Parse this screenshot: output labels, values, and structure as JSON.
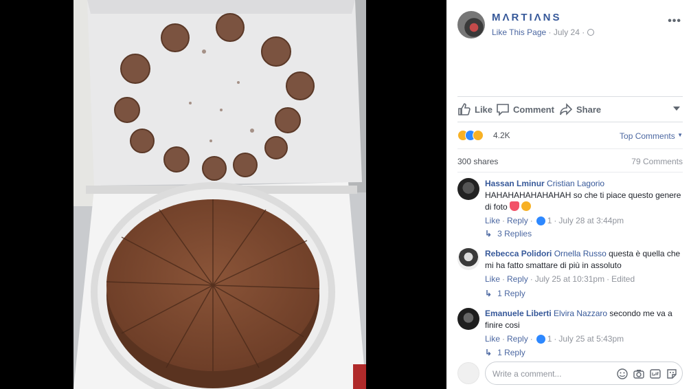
{
  "page": {
    "name": "MΛRTIΛNS",
    "like_link": "Like This Page",
    "date": "July 24",
    "sep": "·"
  },
  "actions": {
    "like": "Like",
    "comment": "Comment",
    "share": "Share"
  },
  "reactions": {
    "count": "4.2K",
    "sort": "Top Comments"
  },
  "stats": {
    "shares": "300 shares",
    "comments": "79 Comments"
  },
  "comments": [
    {
      "author": "Hassan Lminur",
      "tag": "Cristian Lagorio",
      "text": "HAHAHAHAHAHAHAH so che ti piace questo genere di foto",
      "like": "Like",
      "reply": "Reply",
      "likes": "1",
      "time": "July 28 at 3:44pm",
      "replies": "3 Replies"
    },
    {
      "author": "Rebecca Polidori",
      "tag": "Ornella Russo",
      "text": "questa è quella che mi ha fatto smattare di più in assoluto",
      "like": "Like",
      "reply": "Reply",
      "time": "July 25 at 10:31pm",
      "edited": "Edited",
      "replies": "1 Reply"
    },
    {
      "author": "Emanuele Liberti",
      "tag": "Elvira Nazzaro",
      "text": "secondo me va a finire cosi",
      "like": "Like",
      "reply": "Reply",
      "likes": "1",
      "time": "July 25 at 5:43pm",
      "replies": "1 Reply"
    }
  ],
  "composer": {
    "placeholder": "Write a comment..."
  },
  "colors": {
    "link": "#365899",
    "like_blue": "#2d88ff",
    "cake": "#7a4a32"
  }
}
